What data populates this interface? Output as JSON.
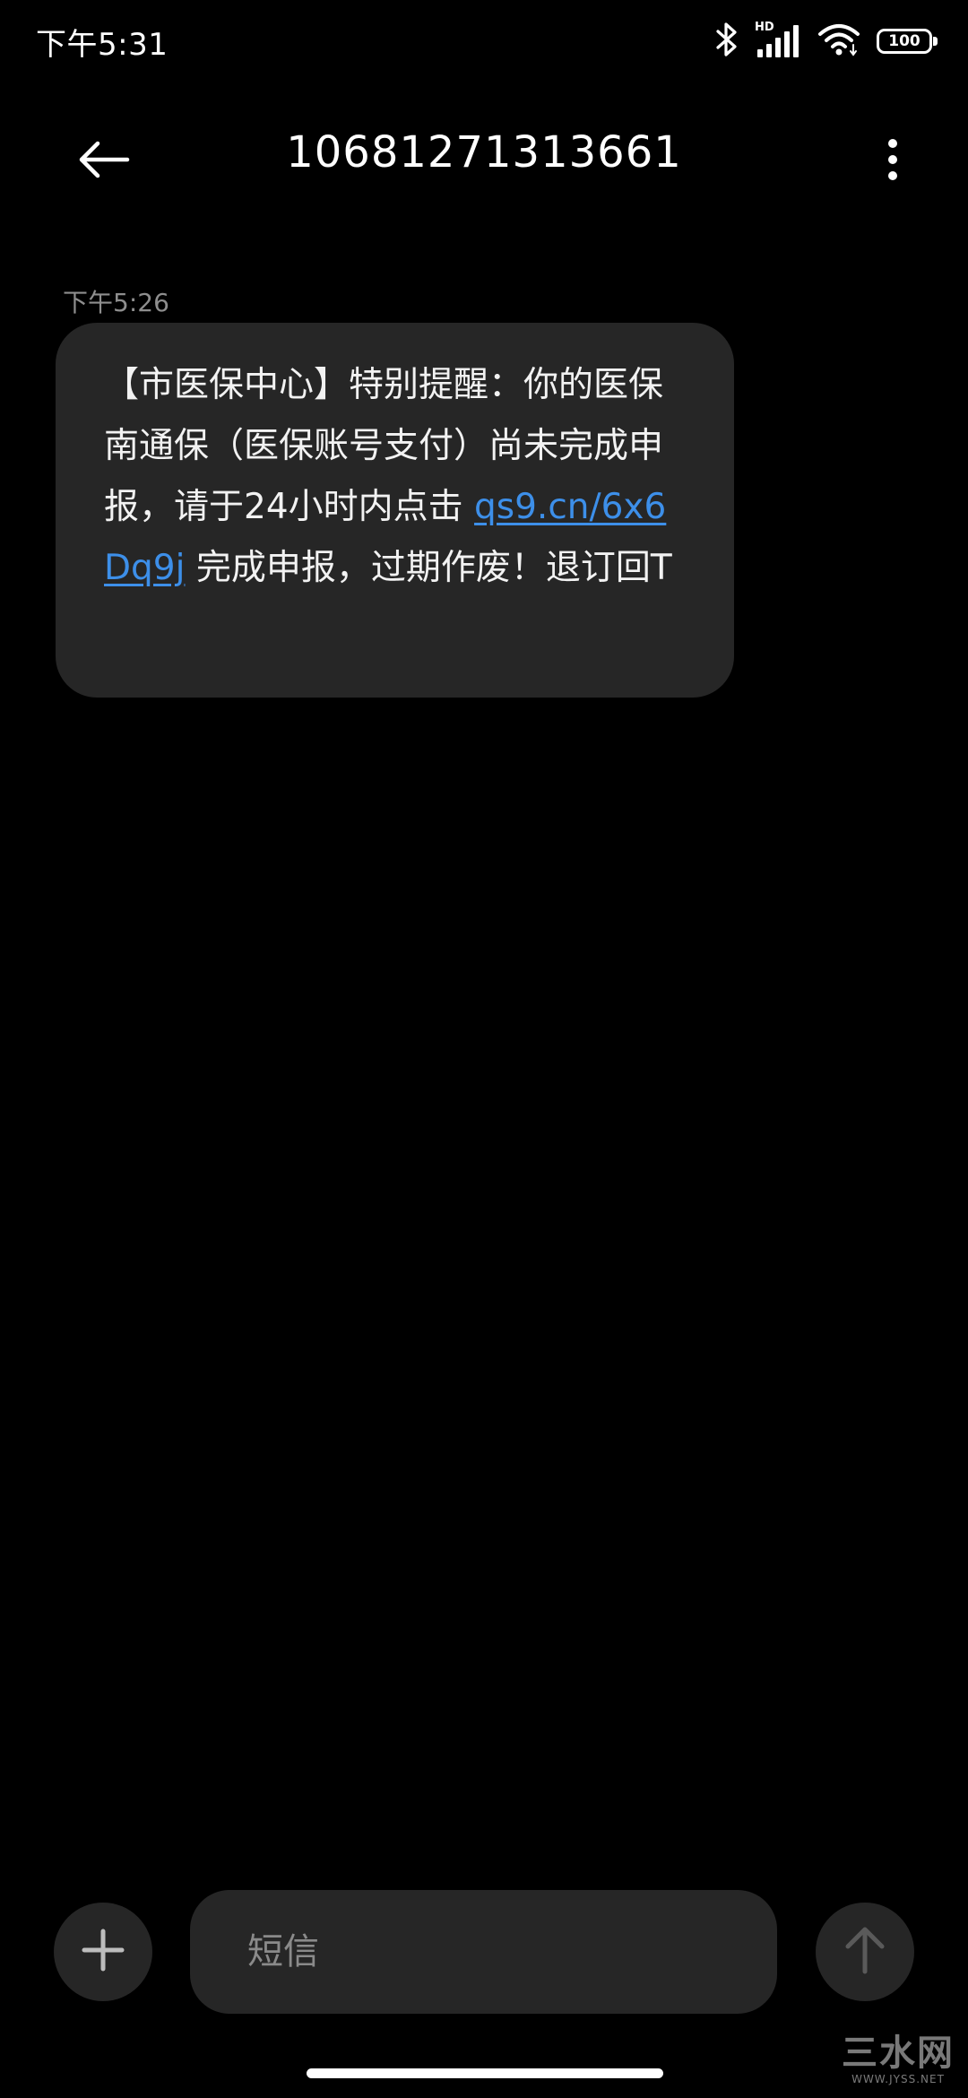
{
  "status_bar": {
    "time": "下午5:31",
    "battery_level": "100",
    "network_label": "HD",
    "icons": [
      "bluetooth-icon",
      "signal-icon",
      "wifi-icon",
      "battery-icon"
    ]
  },
  "header": {
    "title": "10681271313661",
    "back_icon": "arrow-left-icon",
    "more_icon": "more-vertical-icon"
  },
  "messages": [
    {
      "timestamp": "下午5:26",
      "text_before_link": "【市医保中心】特别提醒：你的医保南通保（医保账号支付）尚未完成申报，请于24小时内点击 ",
      "link": "qs9.cn/6x6Dq9j",
      "text_after_link": " 完成申报，过期作废！退订回T"
    }
  ],
  "composer": {
    "placeholder": "短信",
    "attach_icon": "plus-icon",
    "send_icon": "arrow-up-icon"
  },
  "watermark": {
    "main": "三水网",
    "sub": "WWW.JYSS.NET"
  },
  "colors": {
    "background": "#000000",
    "bubble": "#262626",
    "link": "#3d8fe9",
    "timestamp": "#8e8e8e",
    "placeholder": "#8a8a8a"
  }
}
